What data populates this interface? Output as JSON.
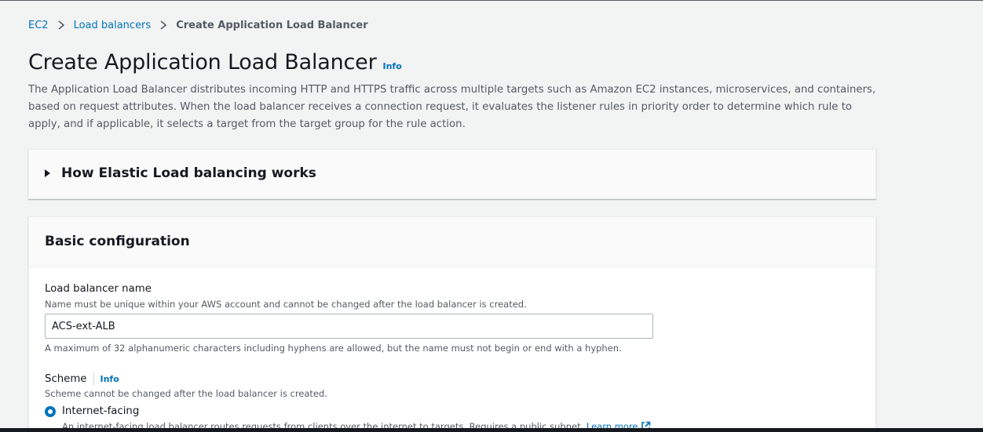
{
  "breadcrumb": {
    "items": [
      "EC2",
      "Load balancers"
    ],
    "current": "Create Application Load Balancer"
  },
  "page": {
    "title": "Create Application Load Balancer",
    "info": "Info",
    "description": "The Application Load Balancer distributes incoming HTTP and HTTPS traffic across multiple targets such as Amazon EC2 instances, microservices, and containers, based on request attributes. When the load balancer receives a connection request, it evaluates the listener rules in priority order to determine which rule to apply, and if applicable, it selects a target from the target group for the rule action."
  },
  "expandable": {
    "title": "How Elastic Load balancing works",
    "icon": "caret-right-icon"
  },
  "basic_config": {
    "title": "Basic configuration",
    "name_field": {
      "label": "Load balancer name",
      "description": "Name must be unique within your AWS account and cannot be changed after the load balancer is created.",
      "value": "ACS-ext-ALB",
      "constraint": "A maximum of 32 alphanumeric characters including hyphens are allowed, but the name must not begin or end with a hyphen."
    },
    "scheme": {
      "label": "Scheme",
      "info": "Info",
      "description": "Scheme cannot be changed after the load balancer is created.",
      "option_label": "Internet-facing",
      "option_description": "An internet-facing load balancer routes requests from clients over the internet to targets. Requires a public subnet.",
      "learn_more": "Learn more"
    }
  },
  "colors": {
    "link": "#0073bb",
    "text": "#16191f",
    "muted": "#545b64",
    "background": "#f2f3f3"
  }
}
